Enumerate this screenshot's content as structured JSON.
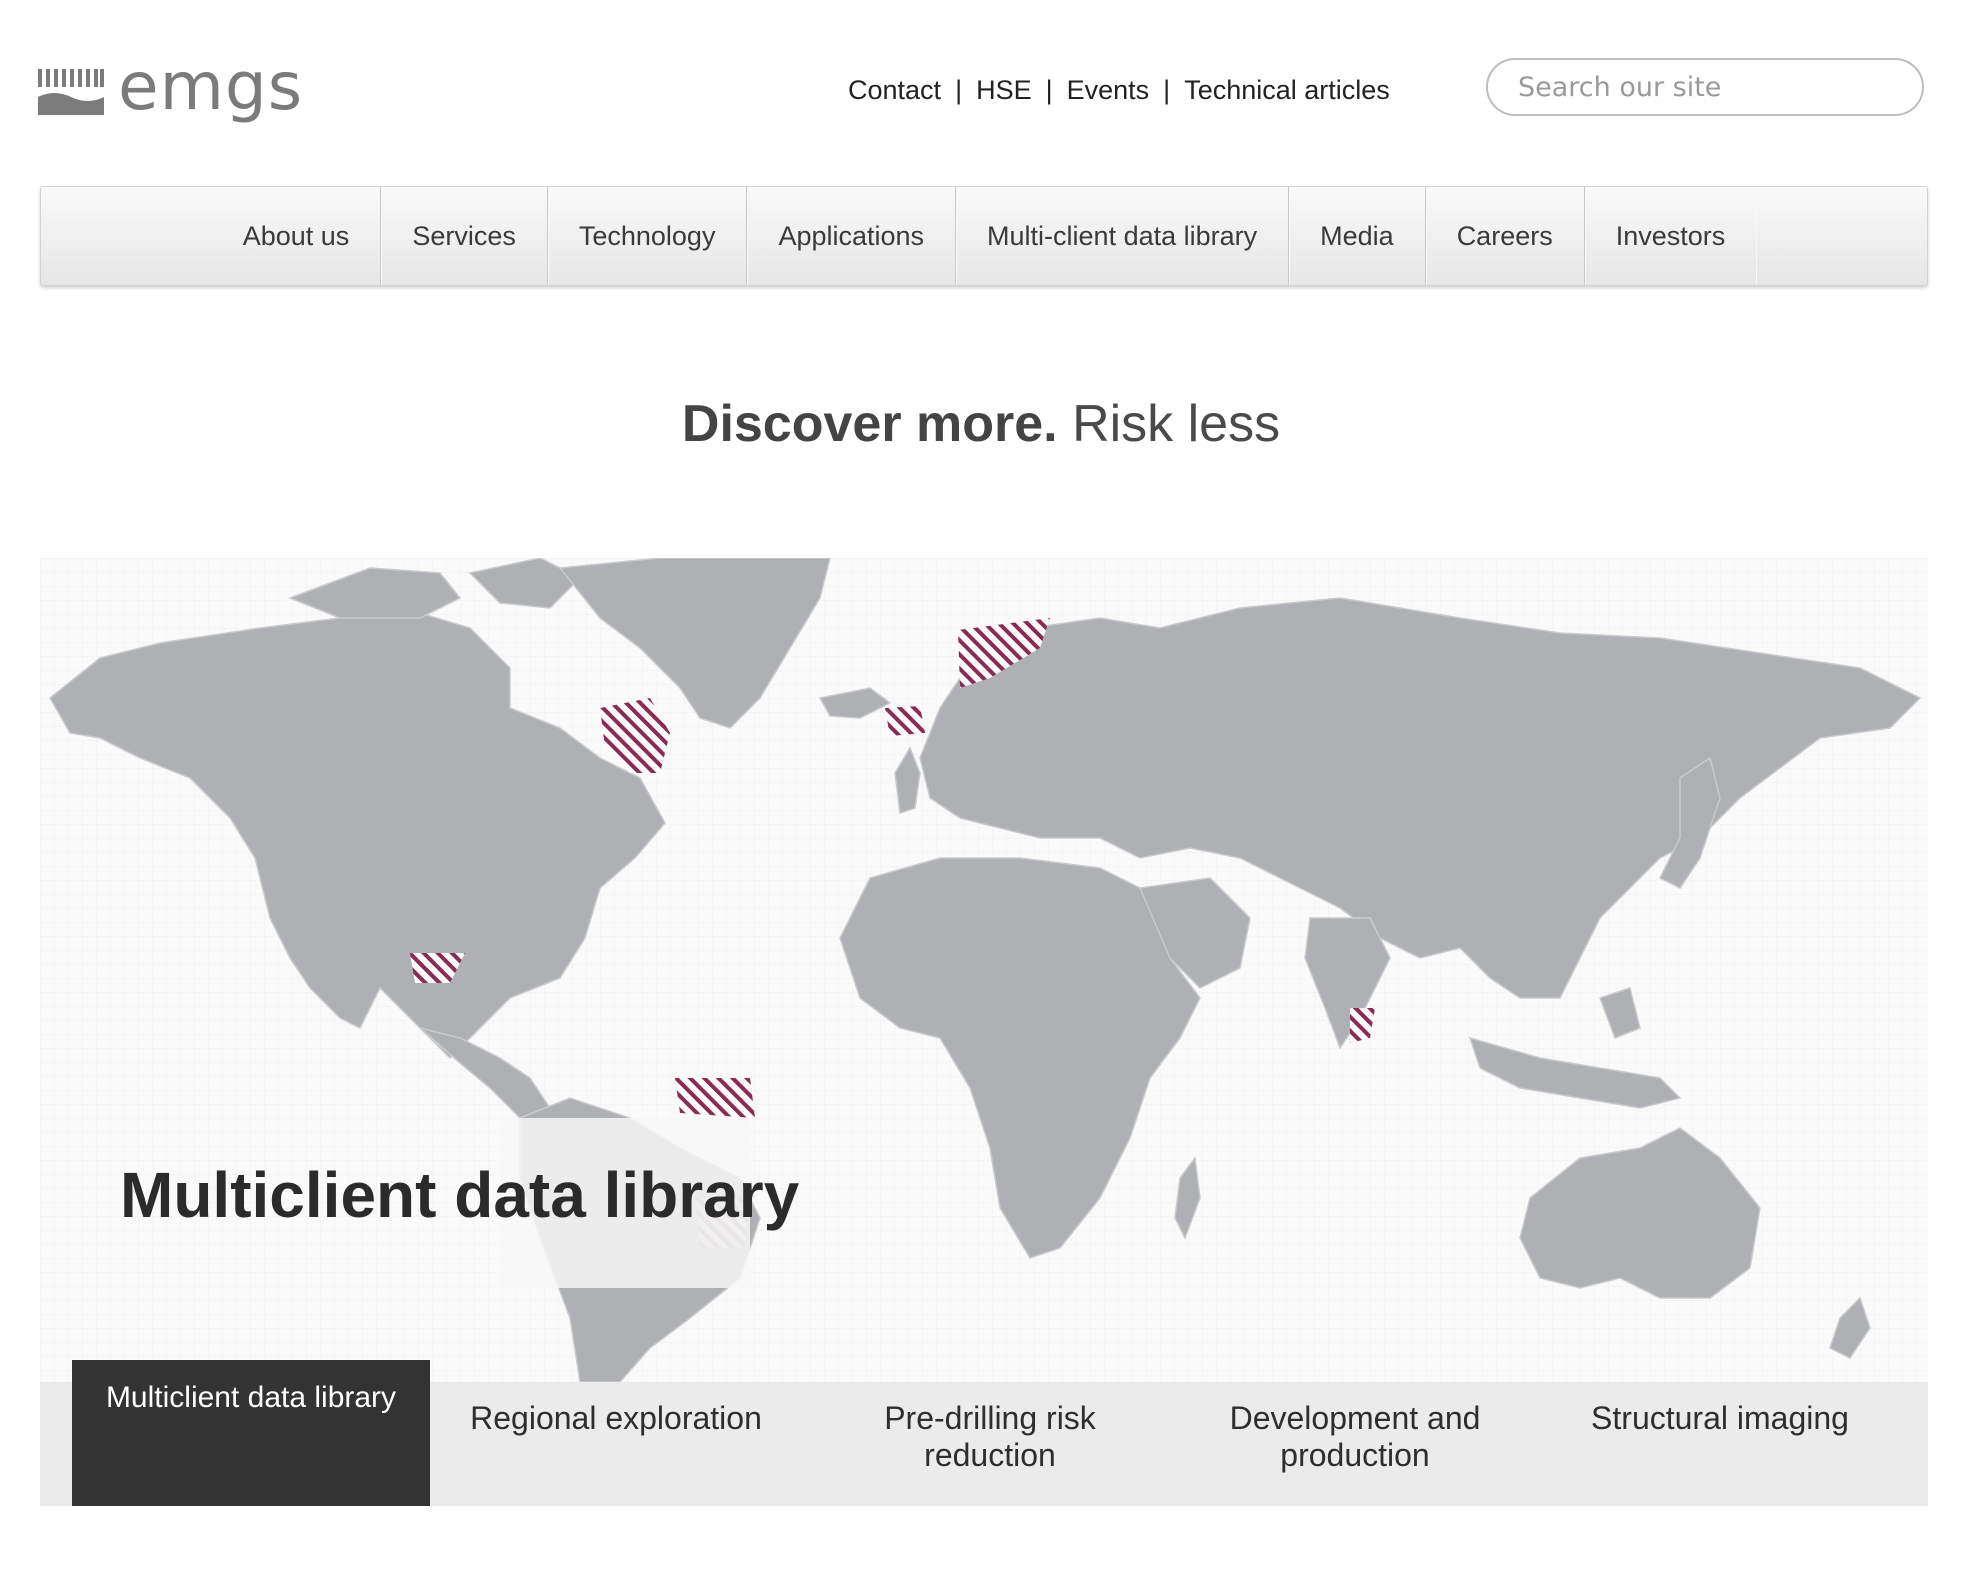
{
  "logo": {
    "text": "emgs",
    "icon": "wave-bars-logo-icon"
  },
  "util_nav": {
    "links": [
      "Contact",
      "HSE",
      "Events",
      "Technical articles"
    ],
    "separator": "|"
  },
  "search": {
    "placeholder": "Search our site",
    "value": ""
  },
  "main_nav": {
    "items": [
      "About us",
      "Services",
      "Technology",
      "Applications",
      "Multi-client data library",
      "Media",
      "Careers",
      "Investors"
    ]
  },
  "tagline": {
    "bold": "Discover more.",
    "rest": " Risk less"
  },
  "hero": {
    "title": "Multiclient data library",
    "map_icon": "world-map-icon",
    "colors": {
      "land": "#aeb0b3",
      "hatch": "#8a2a55",
      "background": "#fafafa"
    }
  },
  "tabs": {
    "items": [
      {
        "label": "Multiclient data library",
        "active": true
      },
      {
        "label": "Regional exploration",
        "active": false
      },
      {
        "label": "Pre-drilling risk reduction",
        "active": false
      },
      {
        "label": "Development and production",
        "active": false
      },
      {
        "label": "Structural imaging",
        "active": false
      }
    ]
  }
}
